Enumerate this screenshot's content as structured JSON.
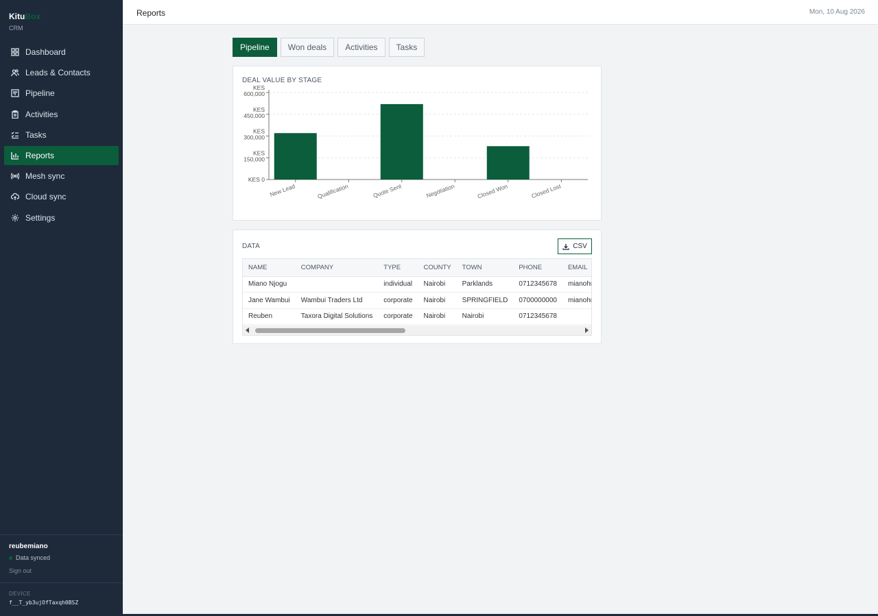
{
  "brand": {
    "name_main": "Kitu",
    "name_accent": "Box",
    "subtitle": "CRM"
  },
  "sidebar": {
    "items": [
      {
        "label": "Dashboard",
        "icon": "grid-icon"
      },
      {
        "label": "Leads & Contacts",
        "icon": "users-icon"
      },
      {
        "label": "Pipeline",
        "icon": "kanban-icon"
      },
      {
        "label": "Activities",
        "icon": "clipboard-icon"
      },
      {
        "label": "Tasks",
        "icon": "checklist-icon"
      },
      {
        "label": "Reports",
        "icon": "bar-chart-icon",
        "active": true
      },
      {
        "label": "Mesh sync",
        "icon": "broadcast-icon"
      },
      {
        "label": "Cloud sync",
        "icon": "cloud-upload-icon"
      },
      {
        "label": "Settings",
        "icon": "gear-icon"
      }
    ]
  },
  "user": {
    "name": "reubemiano",
    "status": "Data synced",
    "signout": "Sign out"
  },
  "device": {
    "label": "DEVICE",
    "id": "f__T_yb3ujOfTaxqh0BSZ"
  },
  "header": {
    "title": "Reports",
    "date": "Mon, 10 Aug 2026"
  },
  "tabs": [
    "Pipeline",
    "Won deals",
    "Activities",
    "Tasks"
  ],
  "chart_card": {
    "title": "DEAL VALUE BY STAGE"
  },
  "chart_data": {
    "type": "bar",
    "title": "DEAL VALUE BY STAGE",
    "categories": [
      "New Lead",
      "Qualification",
      "Quote Sent",
      "Negotiation",
      "Closed Won",
      "Closed Lost"
    ],
    "values": [
      320000,
      0,
      520000,
      0,
      230000,
      0
    ],
    "ylim": [
      0,
      600000
    ],
    "yticks": [
      "KES 0",
      "KES 150,000",
      "KES 300,000",
      "KES 450,000",
      "KES 600,000"
    ],
    "ytick_values": [
      0,
      150000,
      300000,
      450000,
      600000
    ],
    "xlabel": "",
    "ylabel": "",
    "bar_color": "#0b5d3b",
    "grid": true
  },
  "data_card": {
    "title": "DATA",
    "csv_label": "CSV",
    "columns": [
      "NAME",
      "COMPANY",
      "TYPE",
      "COUNTY",
      "TOWN",
      "PHONE",
      "EMAIL"
    ],
    "rows": [
      [
        "Miano Njogu",
        "",
        "individual",
        "Nairobi",
        "Parklands",
        "0712345678",
        "mianohr@gma"
      ],
      [
        "Jane Wambui",
        "Wambui Traders Ltd",
        "corporate",
        "Nairobi",
        "SPRINGFIELD",
        "0700000000",
        "mianohr@gma"
      ],
      [
        "Reuben",
        "Taxora Digital Solutions",
        "corporate",
        "Nairobi",
        "Nairobi",
        "0712345678",
        ""
      ]
    ]
  },
  "colors": {
    "sidebar_bg": "#1e2a3a",
    "accent": "#0b5d3b"
  }
}
